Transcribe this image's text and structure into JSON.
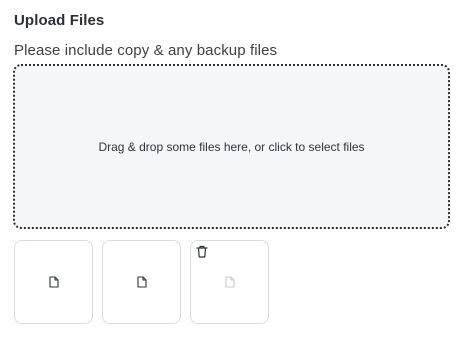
{
  "upload": {
    "title": "Upload Files",
    "subtitle": "Please include copy & any backup files",
    "dropzone_text": "Drag & drop some files here, or click to select files"
  },
  "files": [
    {
      "icon": "file-icon",
      "state": "uploaded"
    },
    {
      "icon": "file-icon",
      "state": "uploaded"
    },
    {
      "icon": "file-icon",
      "state": "faded",
      "action_icon": "trash-icon"
    }
  ],
  "colors": {
    "dropzone_bg": "#f5f6fa",
    "dropzone_border": "#2e2e2e",
    "thumb_border": "#d9dbe3",
    "faded_icon": "#c7c9cf"
  }
}
